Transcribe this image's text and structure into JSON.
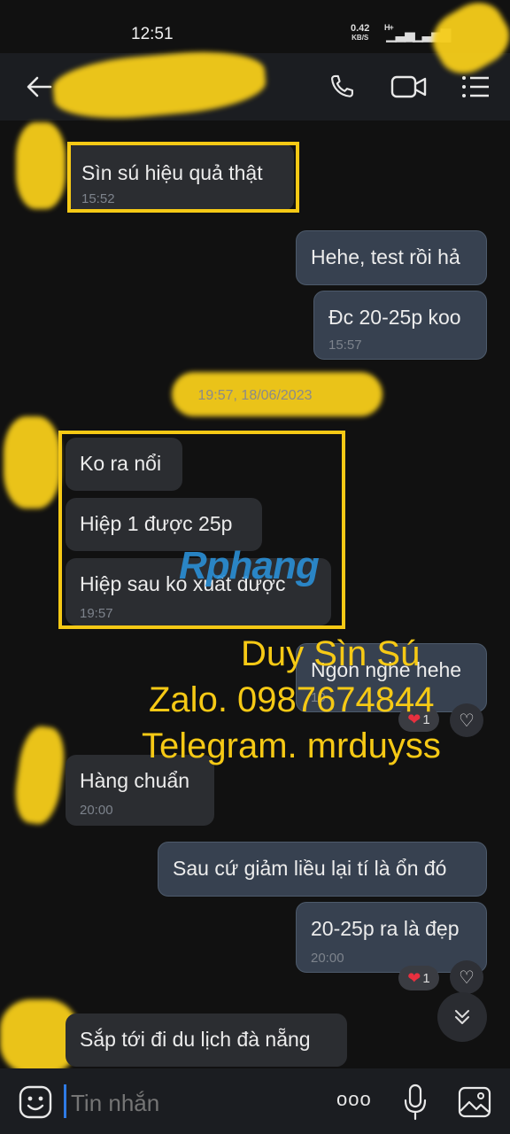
{
  "status": {
    "time": "12:51",
    "speed": "0.42",
    "speed_unit": "KB/S",
    "net_type": "H+"
  },
  "header": {},
  "messages": [
    {
      "text": "Sìn sú hiệu quả thật",
      "time": "15:52"
    },
    {
      "text": "Hehe, test rồi hả"
    },
    {
      "text": "Đc 20-25p koo",
      "time": "15:57"
    },
    {
      "text": "Ko ra nổi"
    },
    {
      "text": "Hiệp 1 được 25p"
    },
    {
      "text": "Hiệp sau ko xuất được",
      "time": "19:57"
    },
    {
      "text": "Ngon nghe hehe",
      "time": "19",
      "reaction_count": "1"
    },
    {
      "text": "Hàng chuẩn",
      "time": "20:00"
    },
    {
      "text": "Sau cứ giảm liều lại tí là ổn đó"
    },
    {
      "text": "20-25p ra là đẹp",
      "time": "20:00",
      "reaction_count": "1"
    },
    {
      "text": "Sắp tới đi du lịch đà nẵng"
    }
  ],
  "date_divider": "19:57, 18/06/2023",
  "watermark": {
    "logo": "Rphang",
    "line1": "Duy Sìn Sú",
    "line2": "Zalo. 0987674844",
    "line3": "Telegram. mrduyss"
  },
  "composer": {
    "placeholder": "Tin nhắn",
    "more": "ooo"
  },
  "colors": {
    "accent": "#f6c915",
    "incoming": "#2b2d31",
    "outgoing": "#374150",
    "heart": "#e8303f"
  }
}
